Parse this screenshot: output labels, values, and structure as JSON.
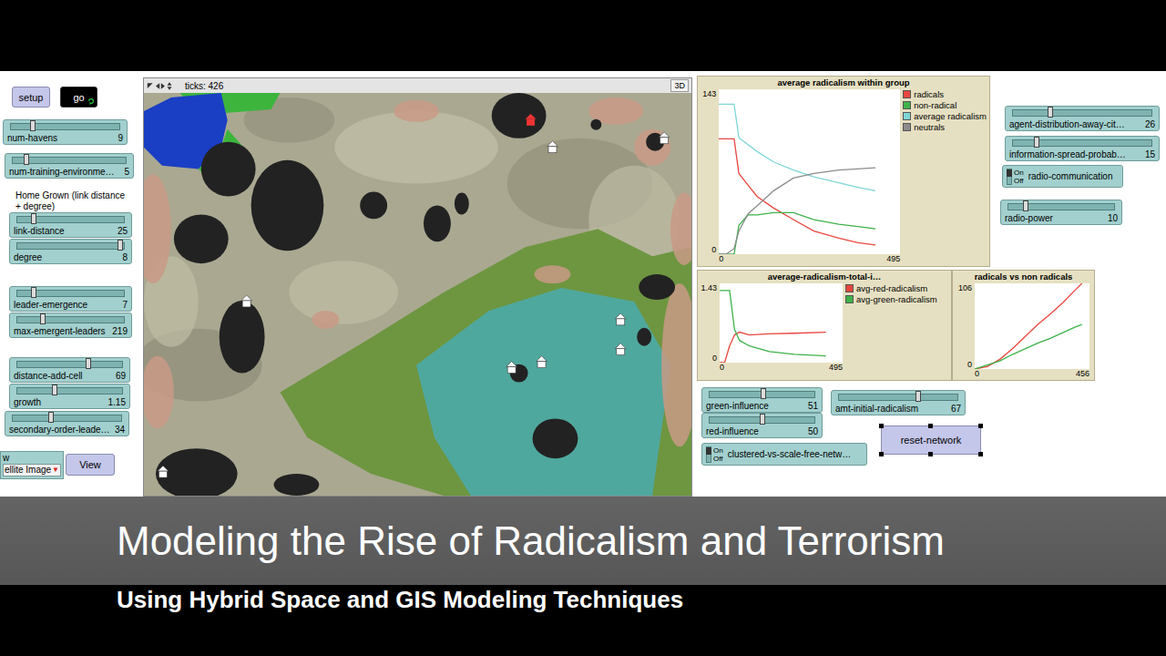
{
  "caption": {
    "title": "Modeling the Rise of Radicalism and Terrorism",
    "subtitle": "Using Hybrid Space and GIS Modeling Techniques"
  },
  "buttons": [
    {
      "label": "setup",
      "pressed": false,
      "kind": "once"
    },
    {
      "label": "go",
      "pressed": true,
      "kind": "forever"
    }
  ],
  "note": "Home Grown (link distance + degree)",
  "sliders": [
    {
      "label": "num-havens",
      "value": "9",
      "level": 0.2
    },
    {
      "label": "num-training-environme…",
      "value": "5",
      "level": 0.12
    },
    {
      "label": "link-distance",
      "value": "25",
      "level": 0.15
    },
    {
      "label": "degree",
      "value": "8",
      "level": 0.97
    },
    {
      "label": "leader-emergence",
      "value": "7",
      "level": 0.15
    },
    {
      "label": "max-emergent-leaders",
      "value": "219",
      "level": 0.24
    },
    {
      "label": "distance-add-cell",
      "value": "69",
      "level": 0.68
    },
    {
      "label": "growth",
      "value": "1.15",
      "level": 0.36
    },
    {
      "label": "secondary-order-leade…",
      "value": "34",
      "level": 0.35
    },
    {
      "label": "agent-distribution-away-cit…",
      "value": "26",
      "level": 0.27
    },
    {
      "label": "information-spread-probab…",
      "value": "15",
      "level": 0.17
    },
    {
      "label": "radio-power",
      "value": "10",
      "level": 0.16
    },
    {
      "label": "green-influence",
      "value": "51",
      "level": 0.51
    },
    {
      "label": "red-influence",
      "value": "50",
      "level": 0.5
    },
    {
      "label": "amt-initial-radicalism",
      "value": "67",
      "level": 0.67
    }
  ],
  "chooser": {
    "label": "w",
    "value": "ellite Image",
    "arrow": "▼"
  },
  "view_button": "View",
  "view": {
    "ticks": "ticks: 426",
    "three_d": "3D"
  },
  "switches": [
    {
      "label": "radio-communication",
      "on_text": "On",
      "off_text": "Off",
      "on": true
    },
    {
      "label": "clustered-vs-scale-free-netw…",
      "on_text": "On",
      "off_text": "Off",
      "on": true
    }
  ],
  "reset_button": {
    "label": "reset-network",
    "selected": true
  },
  "plots": [
    {
      "title": "average radicalism within group",
      "y_max": "143",
      "y_min": "0",
      "x_min": "0",
      "x_max": "495",
      "ticks": [
        0,
        20,
        42,
        55,
        80,
        105,
        150,
        204,
        260,
        328,
        380,
        428
      ],
      "series": [
        {
          "name": "radicals",
          "color": "#e8473f",
          "values": [
            100,
            100,
            100,
            70,
            60,
            50,
            40,
            30,
            20,
            14,
            10,
            8
          ]
        },
        {
          "name": "non-radical",
          "color": "#3fb24a",
          "values": [
            0,
            0,
            0,
            25,
            34,
            34,
            36,
            36,
            30,
            26,
            24,
            22
          ]
        },
        {
          "name": "average radicalism",
          "color": "#7fd6d6",
          "values": [
            130,
            130,
            130,
            101,
            95,
            89,
            80,
            73,
            67,
            62,
            58,
            55
          ]
        },
        {
          "name": "neutrals",
          "color": "#8c8c8c",
          "values": [
            0,
            0,
            5,
            20,
            35,
            42,
            55,
            66,
            70,
            73,
            74,
            75
          ]
        }
      ]
    },
    {
      "title": "average-radicalism-total-i…",
      "y_max": "1.43",
      "y_min": "0",
      "x_min": "0",
      "x_max": "495",
      "ticks": [
        0,
        20,
        40,
        60,
        80,
        120,
        200,
        300,
        428
      ],
      "series": [
        {
          "name": "avg-red-radicalism",
          "color": "#e8473f",
          "values": [
            0,
            0,
            0.3,
            0.5,
            0.55,
            0.5,
            0.52,
            0.53,
            0.55
          ]
        },
        {
          "name": "avg-green-radicalism",
          "color": "#3fb24a",
          "values": [
            1.3,
            1.3,
            1.3,
            0.6,
            0.4,
            0.3,
            0.2,
            0.15,
            0.12
          ]
        }
      ]
    },
    {
      "title": "radicals vs non radicals",
      "y_max": "106",
      "y_min": "0",
      "x_min": "0",
      "x_max": "456",
      "ticks": [
        0,
        50,
        100,
        150,
        200,
        250,
        300,
        350,
        400,
        426
      ],
      "series": [
        {
          "color": "#e8473f",
          "values": [
            0,
            3,
            12,
            25,
            40,
            55,
            68,
            82,
            98,
            106
          ]
        },
        {
          "color": "#3fb24a",
          "values": [
            0,
            5,
            10,
            18,
            25,
            32,
            38,
            45,
            52,
            55
          ]
        }
      ]
    }
  ]
}
